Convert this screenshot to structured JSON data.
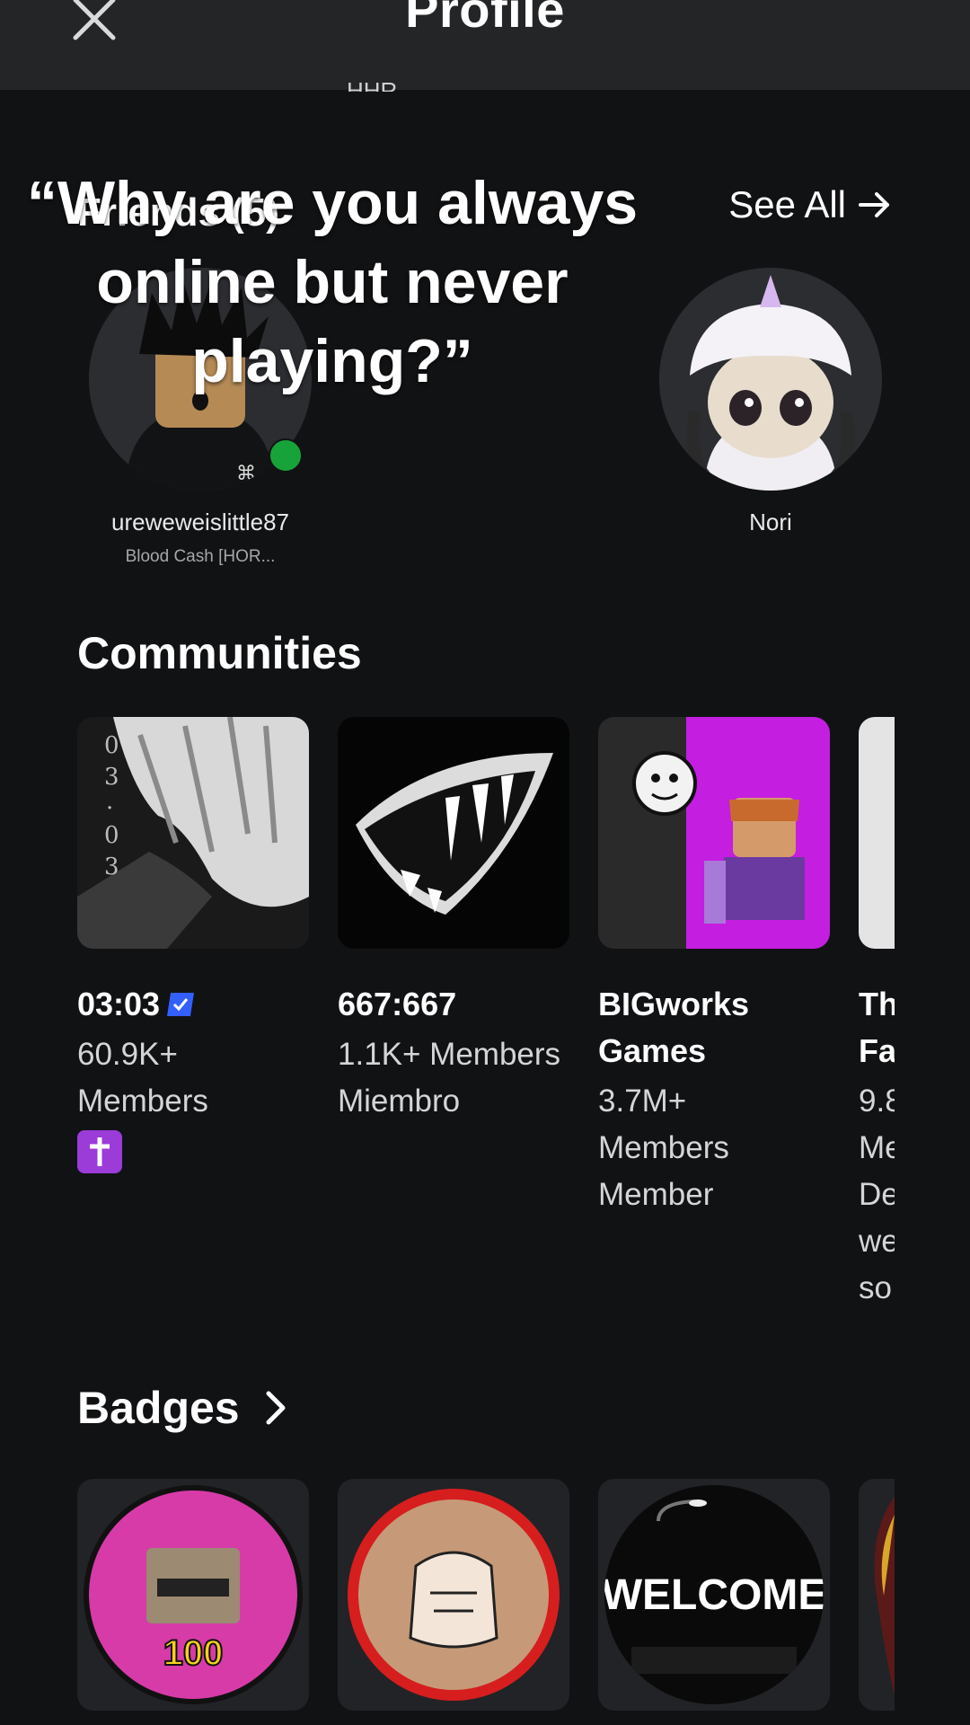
{
  "header": {
    "title": "Profile",
    "clipped_text": "HHR"
  },
  "overlay": {
    "caption": "“Why are you always online but never playing?”"
  },
  "friends": {
    "heading": "Friends (5)",
    "see_all_label": "See All",
    "items": [
      {
        "name": "ureweweislittle87",
        "status": "Blood Cash [HOR...",
        "online": true
      },
      {
        "name": "Nori",
        "status": "",
        "online": false
      }
    ]
  },
  "communities": {
    "heading": "Communities",
    "items": [
      {
        "name": "03:03",
        "lines": [
          "60.9K+",
          "Members"
        ],
        "verified": true,
        "emoji": "cross"
      },
      {
        "name": "667:667",
        "lines": [
          "1.1K+ Members",
          "Miembro"
        ]
      },
      {
        "name": "BIGworks Games",
        "lines": [
          "3.7M+",
          "Members",
          "Member"
        ]
      },
      {
        "name": "Th Fa",
        "lines": [
          "9.8",
          "Me",
          "De",
          "we",
          "so"
        ]
      }
    ]
  },
  "badges": {
    "heading": "Badges",
    "items": [
      {
        "label": "100"
      },
      {
        "label": ""
      },
      {
        "label": "WELCOME"
      },
      {
        "label": ""
      }
    ]
  },
  "colors": {
    "background": "#111214",
    "topbar": "#232527",
    "online": "#18a33a",
    "verified": "#335fff"
  }
}
